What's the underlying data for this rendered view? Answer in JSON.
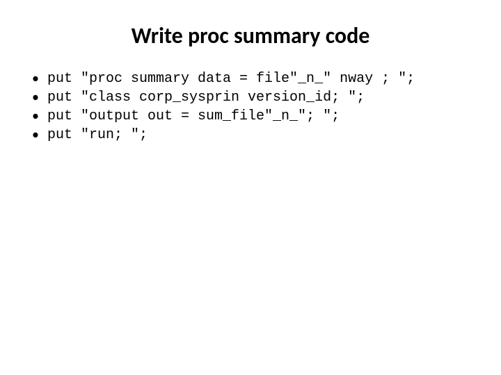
{
  "title": "Write proc summary code",
  "bullets": [
    "put \"proc summary data = file\"_n_\" nway ; \";",
    "put \"class corp_sysprin version_id; \";",
    "put \"output out = sum_file\"_n_\"; \";",
    "put \"run; \";"
  ]
}
